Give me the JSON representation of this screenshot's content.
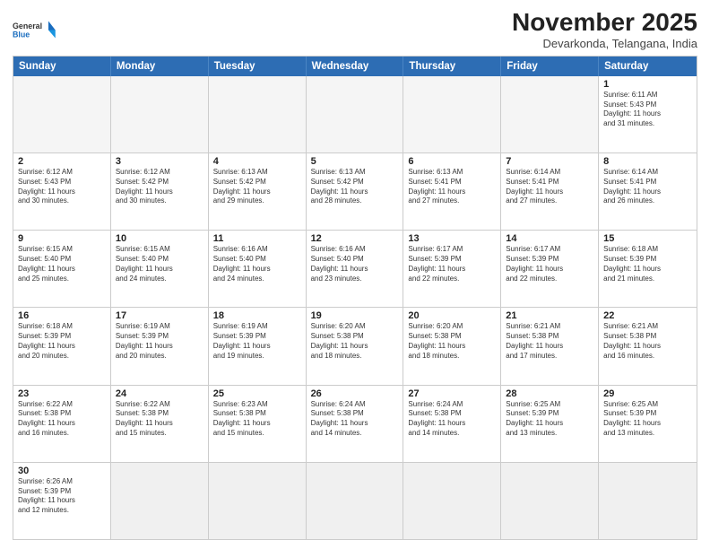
{
  "logo": {
    "line1": "General",
    "line2": "Blue"
  },
  "title": "November 2025",
  "subtitle": "Devarkonda, Telangana, India",
  "headers": [
    "Sunday",
    "Monday",
    "Tuesday",
    "Wednesday",
    "Thursday",
    "Friday",
    "Saturday"
  ],
  "rows": [
    [
      {
        "day": "",
        "info": ""
      },
      {
        "day": "",
        "info": ""
      },
      {
        "day": "",
        "info": ""
      },
      {
        "day": "",
        "info": ""
      },
      {
        "day": "",
        "info": ""
      },
      {
        "day": "",
        "info": ""
      },
      {
        "day": "1",
        "info": "Sunrise: 6:11 AM\nSunset: 5:43 PM\nDaylight: 11 hours\nand 31 minutes."
      }
    ],
    [
      {
        "day": "2",
        "info": "Sunrise: 6:12 AM\nSunset: 5:43 PM\nDaylight: 11 hours\nand 30 minutes."
      },
      {
        "day": "3",
        "info": "Sunrise: 6:12 AM\nSunset: 5:42 PM\nDaylight: 11 hours\nand 30 minutes."
      },
      {
        "day": "4",
        "info": "Sunrise: 6:13 AM\nSunset: 5:42 PM\nDaylight: 11 hours\nand 29 minutes."
      },
      {
        "day": "5",
        "info": "Sunrise: 6:13 AM\nSunset: 5:42 PM\nDaylight: 11 hours\nand 28 minutes."
      },
      {
        "day": "6",
        "info": "Sunrise: 6:13 AM\nSunset: 5:41 PM\nDaylight: 11 hours\nand 27 minutes."
      },
      {
        "day": "7",
        "info": "Sunrise: 6:14 AM\nSunset: 5:41 PM\nDaylight: 11 hours\nand 27 minutes."
      },
      {
        "day": "8",
        "info": "Sunrise: 6:14 AM\nSunset: 5:41 PM\nDaylight: 11 hours\nand 26 minutes."
      }
    ],
    [
      {
        "day": "9",
        "info": "Sunrise: 6:15 AM\nSunset: 5:40 PM\nDaylight: 11 hours\nand 25 minutes."
      },
      {
        "day": "10",
        "info": "Sunrise: 6:15 AM\nSunset: 5:40 PM\nDaylight: 11 hours\nand 24 minutes."
      },
      {
        "day": "11",
        "info": "Sunrise: 6:16 AM\nSunset: 5:40 PM\nDaylight: 11 hours\nand 24 minutes."
      },
      {
        "day": "12",
        "info": "Sunrise: 6:16 AM\nSunset: 5:40 PM\nDaylight: 11 hours\nand 23 minutes."
      },
      {
        "day": "13",
        "info": "Sunrise: 6:17 AM\nSunset: 5:39 PM\nDaylight: 11 hours\nand 22 minutes."
      },
      {
        "day": "14",
        "info": "Sunrise: 6:17 AM\nSunset: 5:39 PM\nDaylight: 11 hours\nand 22 minutes."
      },
      {
        "day": "15",
        "info": "Sunrise: 6:18 AM\nSunset: 5:39 PM\nDaylight: 11 hours\nand 21 minutes."
      }
    ],
    [
      {
        "day": "16",
        "info": "Sunrise: 6:18 AM\nSunset: 5:39 PM\nDaylight: 11 hours\nand 20 minutes."
      },
      {
        "day": "17",
        "info": "Sunrise: 6:19 AM\nSunset: 5:39 PM\nDaylight: 11 hours\nand 20 minutes."
      },
      {
        "day": "18",
        "info": "Sunrise: 6:19 AM\nSunset: 5:39 PM\nDaylight: 11 hours\nand 19 minutes."
      },
      {
        "day": "19",
        "info": "Sunrise: 6:20 AM\nSunset: 5:38 PM\nDaylight: 11 hours\nand 18 minutes."
      },
      {
        "day": "20",
        "info": "Sunrise: 6:20 AM\nSunset: 5:38 PM\nDaylight: 11 hours\nand 18 minutes."
      },
      {
        "day": "21",
        "info": "Sunrise: 6:21 AM\nSunset: 5:38 PM\nDaylight: 11 hours\nand 17 minutes."
      },
      {
        "day": "22",
        "info": "Sunrise: 6:21 AM\nSunset: 5:38 PM\nDaylight: 11 hours\nand 16 minutes."
      }
    ],
    [
      {
        "day": "23",
        "info": "Sunrise: 6:22 AM\nSunset: 5:38 PM\nDaylight: 11 hours\nand 16 minutes."
      },
      {
        "day": "24",
        "info": "Sunrise: 6:22 AM\nSunset: 5:38 PM\nDaylight: 11 hours\nand 15 minutes."
      },
      {
        "day": "25",
        "info": "Sunrise: 6:23 AM\nSunset: 5:38 PM\nDaylight: 11 hours\nand 15 minutes."
      },
      {
        "day": "26",
        "info": "Sunrise: 6:24 AM\nSunset: 5:38 PM\nDaylight: 11 hours\nand 14 minutes."
      },
      {
        "day": "27",
        "info": "Sunrise: 6:24 AM\nSunset: 5:38 PM\nDaylight: 11 hours\nand 14 minutes."
      },
      {
        "day": "28",
        "info": "Sunrise: 6:25 AM\nSunset: 5:39 PM\nDaylight: 11 hours\nand 13 minutes."
      },
      {
        "day": "29",
        "info": "Sunrise: 6:25 AM\nSunset: 5:39 PM\nDaylight: 11 hours\nand 13 minutes."
      }
    ],
    [
      {
        "day": "30",
        "info": "Sunrise: 6:26 AM\nSunset: 5:39 PM\nDaylight: 11 hours\nand 12 minutes."
      },
      {
        "day": "",
        "info": ""
      },
      {
        "day": "",
        "info": ""
      },
      {
        "day": "",
        "info": ""
      },
      {
        "day": "",
        "info": ""
      },
      {
        "day": "",
        "info": ""
      },
      {
        "day": "",
        "info": ""
      }
    ]
  ]
}
